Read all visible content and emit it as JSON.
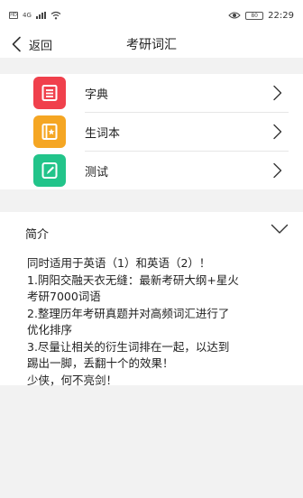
{
  "status_bar": {
    "network_label": "4G",
    "battery_level": "80",
    "time": "22:29"
  },
  "nav": {
    "back_label": "返回",
    "title": "考研词汇"
  },
  "menu": {
    "items": [
      {
        "label": "字典",
        "icon": "dictionary-icon",
        "color": "#f0404c"
      },
      {
        "label": "生词本",
        "icon": "wordbook-icon",
        "color": "#f5a623"
      },
      {
        "label": "测试",
        "icon": "test-icon",
        "color": "#22c48a"
      }
    ]
  },
  "intro": {
    "title": "简介",
    "lines": [
      "同时适用于英语（1）和英语（2）！",
      "1.阴阳交融天衣无缝：最新考研大纲+星火",
      "考研7000词语",
      "2.整理历年考研真题并对高频词汇进行了",
      "优化排序",
      "3.尽量让相关的衍生词排在一起，以达到",
      "踢出一脚，丢翻十个的效果！",
      "少侠，何不亮剑！"
    ]
  },
  "colors": {
    "background": "#f2f2f2",
    "surface": "#ffffff",
    "text": "#222222",
    "divider": "#e6e6e6"
  }
}
